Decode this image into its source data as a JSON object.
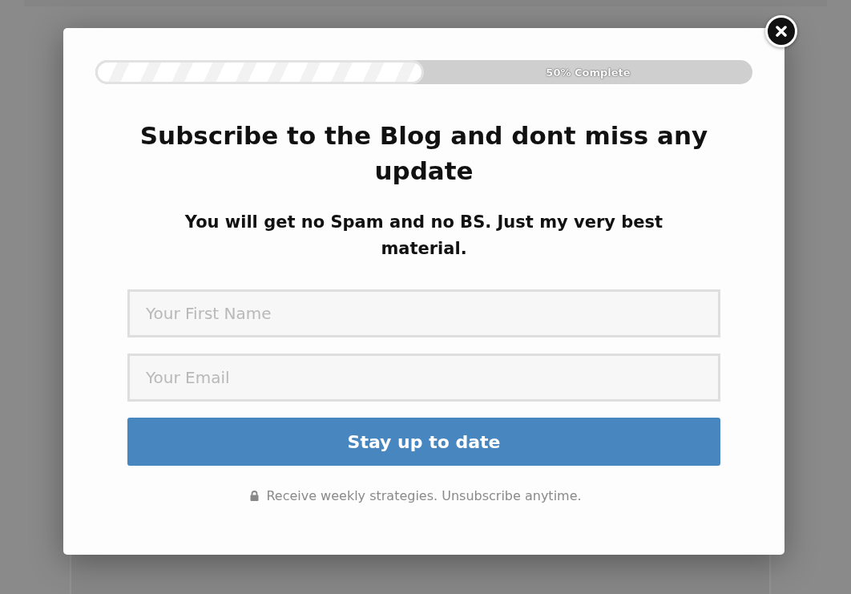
{
  "progress": {
    "level": 0.5,
    "label": "50% Complete"
  },
  "title": "Subscribe to the Blog and dont miss any update",
  "subtitle": "You will get no Spam and no BS. Just my very best material.",
  "fields": [
    {
      "placeholder": "Your First Name"
    },
    {
      "placeholder": "Your Email"
    }
  ],
  "submit": "Stay up to date",
  "footer": "Receive weekly strategies. Unsubscribe anytime."
}
